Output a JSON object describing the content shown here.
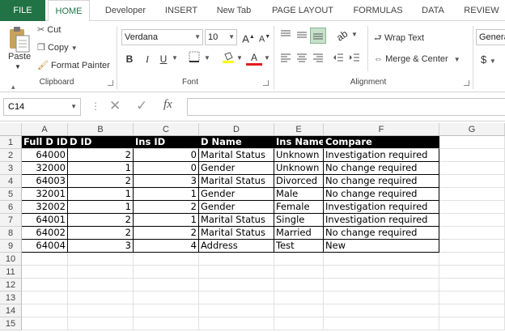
{
  "tabs": [
    "FILE",
    "HOME",
    "Developer",
    "INSERT",
    "New Tab",
    "PAGE LAYOUT",
    "FORMULAS",
    "DATA",
    "REVIEW"
  ],
  "ribbon": {
    "clipboard": {
      "paste": "Paste",
      "cut": "Cut",
      "copy": "Copy",
      "format_painter": "Format Painter",
      "label": "Clipboard"
    },
    "font": {
      "name": "Verdana",
      "size": "10",
      "bold": "B",
      "italic": "I",
      "underline": "U",
      "grow": "A",
      "shrink": "A",
      "color": "A",
      "label": "Font"
    },
    "alignment": {
      "wrap": "Wrap Text",
      "merge": "Merge & Center",
      "label": "Alignment"
    },
    "number": {
      "format": "Genera",
      "currency": "$"
    }
  },
  "formula_bar": {
    "name_box": "C14",
    "fx": "fx",
    "value": ""
  },
  "columns": [
    "A",
    "B",
    "C",
    "D",
    "E",
    "F",
    "G"
  ],
  "row_numbers": [
    "1",
    "2",
    "3",
    "4",
    "5",
    "6",
    "7",
    "8",
    "9",
    "10",
    "11",
    "12",
    "13",
    "14",
    "15"
  ],
  "table": {
    "headers": [
      "Full D ID",
      "D ID",
      "Ins ID",
      "D Name",
      "Ins Name",
      "Compare"
    ],
    "rows": [
      [
        "64000",
        "2",
        "0",
        "Marital Status",
        "Unknown",
        "Investigation required"
      ],
      [
        "32000",
        "1",
        "0",
        "Gender",
        "Unknown",
        "No change required"
      ],
      [
        "64003",
        "2",
        "3",
        "Marital Status",
        "Divorced",
        "No change required"
      ],
      [
        "32001",
        "1",
        "1",
        "Gender",
        "Male",
        "No change required"
      ],
      [
        "32002",
        "1",
        "2",
        "Gender",
        "Female",
        "Investigation required"
      ],
      [
        "64001",
        "2",
        "1",
        "Marital Status",
        "Single",
        "Investigation required"
      ],
      [
        "64002",
        "2",
        "2",
        "Marital Status",
        "Married",
        "No change required"
      ],
      [
        "64004",
        "3",
        "4",
        "Address",
        "Test",
        "New"
      ]
    ]
  },
  "colors": {
    "excel_green": "#217346",
    "header_bg": "#000000",
    "header_fg": "#ffffff"
  }
}
